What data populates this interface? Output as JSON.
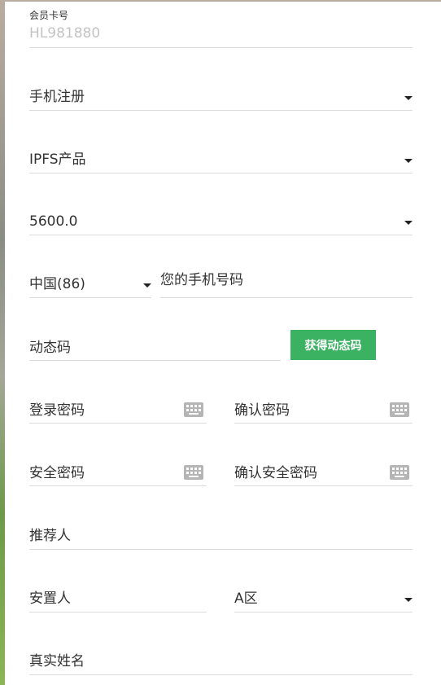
{
  "member_card": {
    "label": "会员卡号",
    "value": "HL981880"
  },
  "registration_type": {
    "value": "手机注册"
  },
  "product": {
    "value": "IPFS产品"
  },
  "amount": {
    "value": "5600.0"
  },
  "country_code": {
    "value": "中国(86)"
  },
  "phone": {
    "placeholder": "您的手机号码"
  },
  "dynamic_code": {
    "placeholder": "动态码",
    "button_label": "获得动态码"
  },
  "login_password": {
    "placeholder": "登录密码",
    "icon": "keyboard-icon"
  },
  "confirm_password": {
    "placeholder": "确认密码",
    "icon": "keyboard-icon"
  },
  "security_password": {
    "placeholder": "安全密码",
    "icon": "keyboard-icon"
  },
  "confirm_security_password": {
    "placeholder": "确认安全密码",
    "icon": "keyboard-icon"
  },
  "referrer": {
    "placeholder": "推荐人"
  },
  "placement": {
    "placeholder": "安置人"
  },
  "zone": {
    "value": "A区"
  },
  "real_name": {
    "placeholder": "真实姓名"
  },
  "colors": {
    "accent": "#3bb162",
    "border": "#dcdcdc",
    "text": "#333333",
    "muted": "#c3c3c3"
  }
}
